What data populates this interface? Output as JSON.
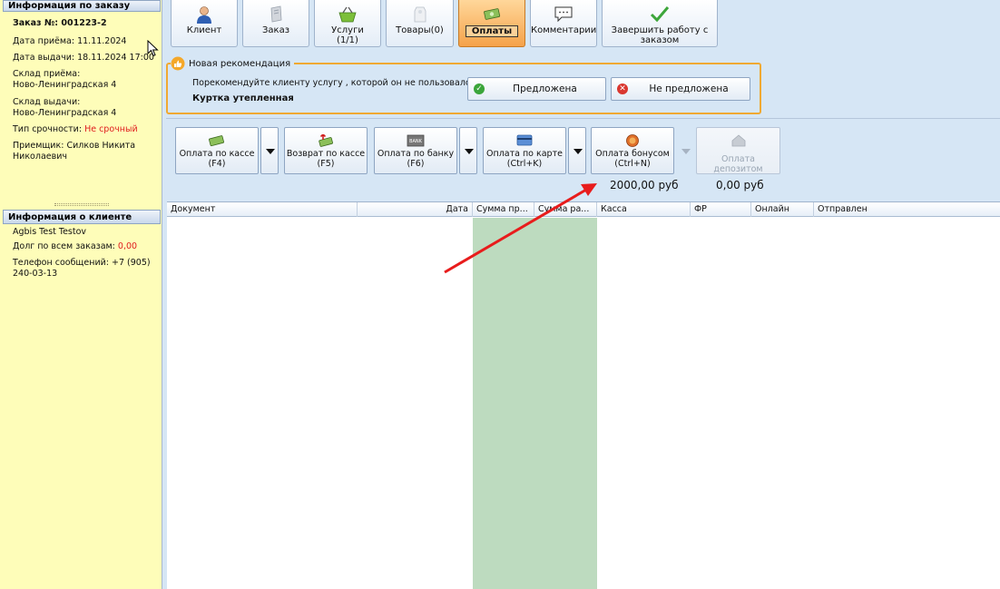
{
  "order_info": {
    "header": "Информация по заказу",
    "order_number": "Заказ №: 001223-2",
    "received_date": "Дата приёма: 11.11.2024",
    "issue_date": "Дата выдачи: 18.11.2024 17:00",
    "receive_warehouse_label": "Склад приёма:",
    "receive_warehouse_value": "Ново-Ленинградская 4",
    "issue_warehouse_label": "Склад выдачи:",
    "issue_warehouse_value": "Ново-Ленинградская 4",
    "urgency_label": "Тип срочности:",
    "urgency_value": "Не срочный",
    "receiver_label": "Приемщик:",
    "receiver_value_1": "Силков Никита",
    "receiver_value_2": "Николаевич"
  },
  "client_info": {
    "header": "Информация о клиенте",
    "name": "Agbis Test Testov",
    "debt_label": "Долг по всем заказам:",
    "debt_value": "0,00",
    "phone_line_1": "Телефон сообщений: +7 (905)",
    "phone_line_2": "240-03-13"
  },
  "top_tabs": [
    {
      "label": "Клиент",
      "icon": "client-icon"
    },
    {
      "label": "Заказ",
      "icon": "order-icon"
    },
    {
      "label": "Услуги",
      "label2": "(1/1)",
      "icon": "basket-icon"
    },
    {
      "label": "Товары(0)",
      "icon": "goods-icon"
    },
    {
      "label": "Оплаты",
      "icon": "money-icon",
      "active": true
    },
    {
      "label": "Комментарии",
      "icon": "comment-icon"
    },
    {
      "label": "Завершить работу с",
      "label2": "заказом",
      "icon": "checkmark-icon"
    }
  ],
  "recommendation": {
    "title": "Новая рекомендация",
    "text": "Порекомендуйте клиенту услугу , которой он не пользовался",
    "item": "Куртка утепленная",
    "offered_label": "Предложена",
    "not_offered_label": "Не предложена"
  },
  "payments": {
    "cash": {
      "label": "Оплата по кассе",
      "shortcut": "(F4)"
    },
    "refund": {
      "label": "Возврат по кассе",
      "shortcut": "(F5)"
    },
    "bank": {
      "label": "Оплата по банку",
      "shortcut": "(F6)"
    },
    "card": {
      "label": "Оплата по карте",
      "shortcut": "(Ctrl+K)"
    },
    "bonus": {
      "label": "Оплата бонусом",
      "shortcut": "(Ctrl+N)"
    },
    "deposit": {
      "label": "Оплата депозитом"
    },
    "bonus_amount": "2000,00 руб",
    "deposit_amount": "0,00 руб"
  },
  "grid": {
    "columns": [
      "Документ",
      "Дата",
      "Сумма пр...",
      "Сумма ра...",
      "Касса",
      "ФР",
      "Онлайн",
      "Отправлен"
    ]
  },
  "colors": {
    "panel_yellow": "#fefdb9",
    "main_blue": "#d6e6f5",
    "active_tab_orange": "#f5a24a",
    "recommendation_border": "#f0a932",
    "urgency_red": "#e02020",
    "column_green": "#bddbbf",
    "annotation_arrow": "#e81c1c"
  }
}
